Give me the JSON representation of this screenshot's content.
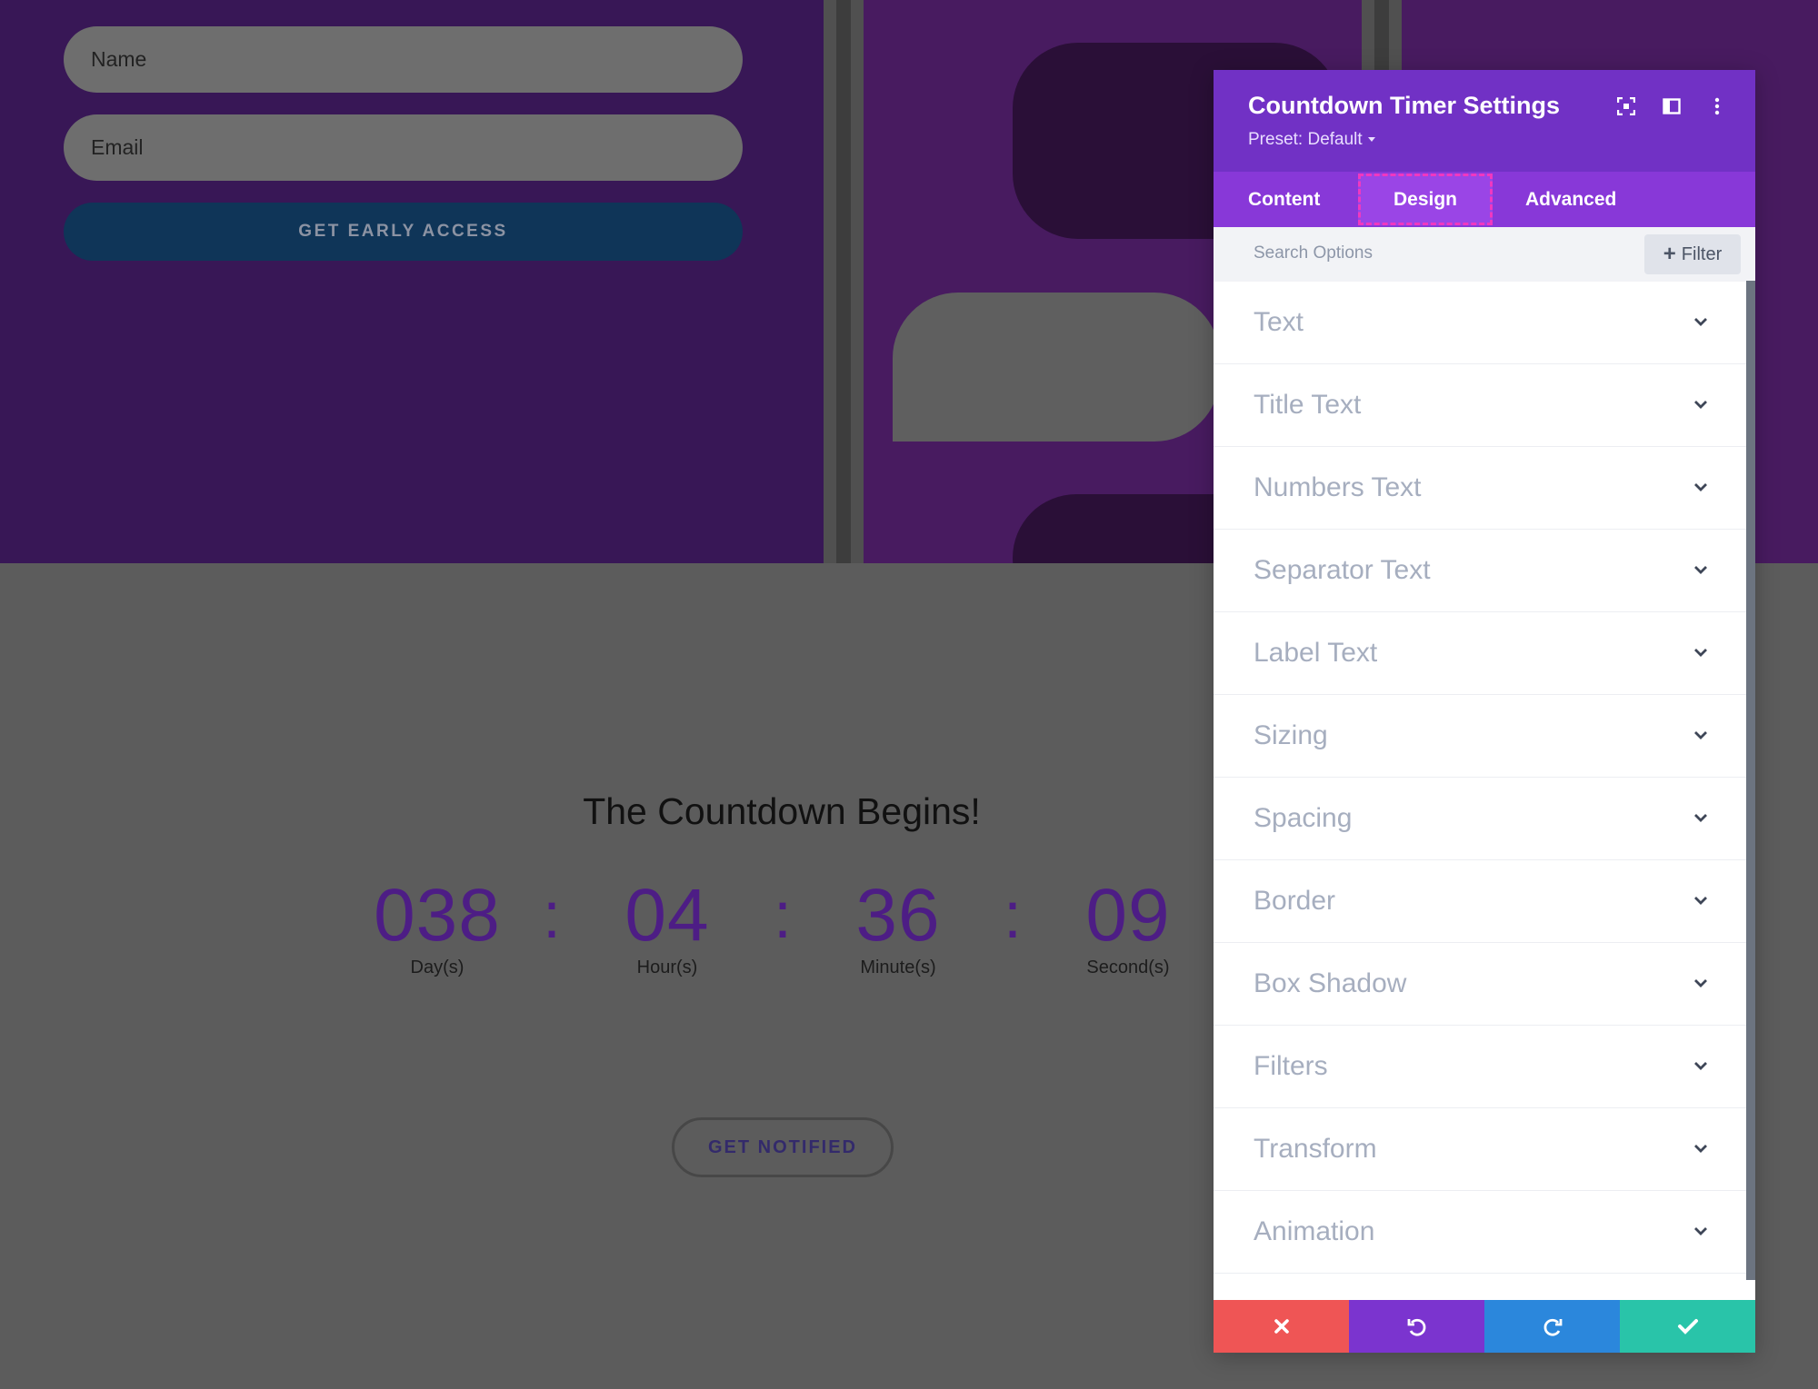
{
  "hero": {
    "name_placeholder": "Name",
    "email_placeholder": "Email",
    "early_access_label": "GET EARLY ACCESS"
  },
  "countdown": {
    "title": "The Countdown Begins!",
    "units": [
      {
        "value": "038",
        "label": "Day(s)"
      },
      {
        "value": "04",
        "label": "Hour(s)"
      },
      {
        "value": "36",
        "label": "Minute(s)"
      },
      {
        "value": "09",
        "label": "Second(s)"
      }
    ],
    "separator": ":",
    "notify_label": "GET NOTIFIED"
  },
  "modal": {
    "title": "Countdown Timer Settings",
    "preset": "Preset: Default",
    "header_icons": [
      "fullscreen-icon",
      "split-view-icon",
      "more-vertical-icon"
    ],
    "tabs": [
      "Content",
      "Design",
      "Advanced"
    ],
    "active_tab": "Design",
    "search_placeholder": "Search Options",
    "filter_label": "Filter",
    "options": [
      "Text",
      "Title Text",
      "Numbers Text",
      "Separator Text",
      "Label Text",
      "Sizing",
      "Spacing",
      "Border",
      "Box Shadow",
      "Filters",
      "Transform",
      "Animation"
    ],
    "footer_buttons": [
      "close-icon",
      "undo-icon",
      "redo-icon",
      "check-icon"
    ]
  },
  "colors": {
    "header": "#7131c5",
    "tabs": "#8838d8",
    "cancel": "#ef5555",
    "undo": "#7b34cf",
    "redo": "#2b87dc",
    "save": "#29c4a9",
    "countdown_number": "#4d1d85"
  }
}
